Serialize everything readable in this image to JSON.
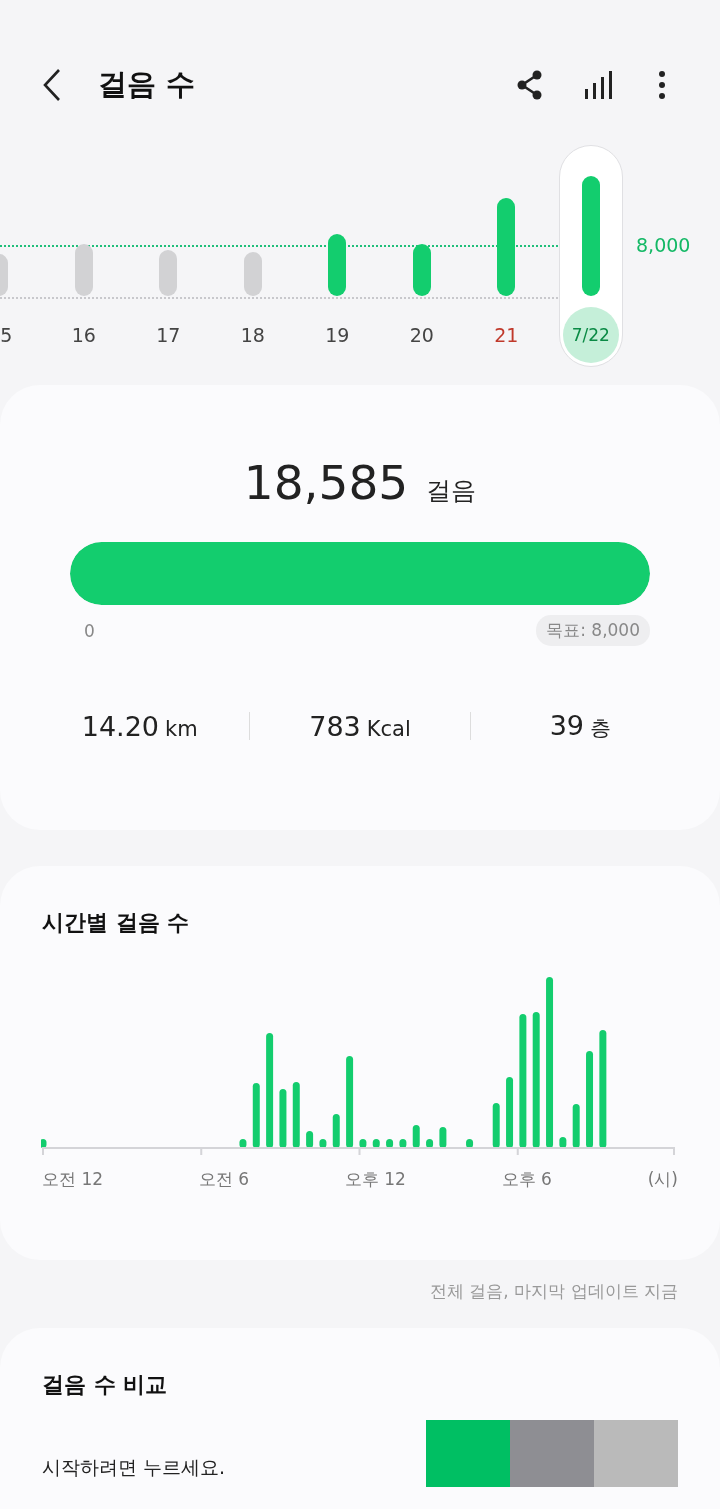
{
  "header": {
    "title": "걸음 수"
  },
  "week": {
    "goal_label": "8,000",
    "days": [
      {
        "label": "5",
        "goal_met": false,
        "weekend": false,
        "selected": false
      },
      {
        "label": "16",
        "goal_met": false,
        "weekend": false,
        "selected": false
      },
      {
        "label": "17",
        "goal_met": false,
        "weekend": false,
        "selected": false
      },
      {
        "label": "18",
        "goal_met": false,
        "weekend": false,
        "selected": false
      },
      {
        "label": "19",
        "goal_met": true,
        "weekend": false,
        "selected": false
      },
      {
        "label": "20",
        "goal_met": true,
        "weekend": false,
        "selected": false
      },
      {
        "label": "21",
        "goal_met": true,
        "weekend": true,
        "selected": false
      },
      {
        "label": "7/22",
        "goal_met": true,
        "weekend": false,
        "selected": true
      }
    ]
  },
  "summary": {
    "steps": "18,585",
    "unit": "걸음",
    "level": 1,
    "start": "0",
    "goal": "목표: 8,000",
    "stats": [
      {
        "value": "14.20",
        "unit": "km"
      },
      {
        "value": "783",
        "unit": "Kcal"
      },
      {
        "value": "39",
        "unit": "층"
      }
    ]
  },
  "hourly": {
    "title": "시간별 걸음 수",
    "axis_labels": [
      "오전 12",
      "오전 6",
      "오후 12",
      "오후 6",
      "(시)"
    ]
  },
  "footnote": "전체 걸음, 마지막 업데이트 지금",
  "compare": {
    "title": "걸음 수 비교",
    "prompt": "시작하려면 누르세요.",
    "swatches": [
      {
        "color": "#00bf63"
      },
      {
        "color": "#8e8e93"
      },
      {
        "color": "#bababa"
      }
    ]
  }
}
